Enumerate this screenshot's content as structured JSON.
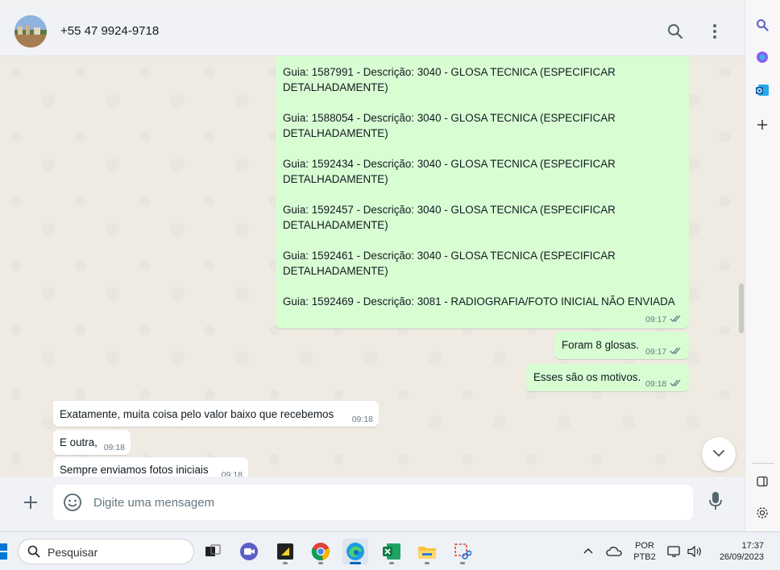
{
  "header": {
    "contact_name": "+55 47 9924-9718"
  },
  "outgoing_list": {
    "lines": [
      {
        "line1": "Guia: 1587991 - Descrição: 3040 - GLOSA TECNICA (ESPECIFICAR",
        "line2": "DETALHADAMENTE)"
      },
      {
        "line1": "Guia: 1588054 - Descrição: 3040 - GLOSA TECNICA (ESPECIFICAR",
        "line2": "DETALHADAMENTE)"
      },
      {
        "line1": "Guia: 1592434 - Descrição: 3040 - GLOSA TECNICA (ESPECIFICAR",
        "line2": "DETALHADAMENTE)"
      },
      {
        "line1": "Guia: 1592457 - Descrição: 3040 - GLOSA TECNICA (ESPECIFICAR",
        "line2": "DETALHADAMENTE)"
      },
      {
        "line1": "Guia: 1592461 - Descrição: 3040 - GLOSA TECNICA (ESPECIFICAR",
        "line2": "DETALHADAMENTE)"
      },
      {
        "line1": "Guia: 1592469 - Descrição: 3081 - RADIOGRAFIA/FOTO INICIAL NÃO ENVIADA",
        "line2": ""
      }
    ],
    "time": "09:17"
  },
  "messages": [
    {
      "text": "Foram 8 glosas.",
      "time": "09:17",
      "direction": "out"
    },
    {
      "text": "Esses são os motivos.",
      "time": "09:18",
      "direction": "out"
    },
    {
      "text": "Exatamente, muita coisa pelo valor baixo que recebemos",
      "time": "09:18",
      "direction": "in"
    },
    {
      "text": "E outra,",
      "time": "09:18",
      "direction": "in"
    },
    {
      "text": "Sempre enviamos fotos iniciais",
      "time": "09:18",
      "direction": "in"
    }
  ],
  "composer": {
    "placeholder": "Digite uma mensagem"
  },
  "taskbar": {
    "search_label": "Pesquisar",
    "lang_top": "POR",
    "lang_bottom": "PTB2",
    "clock_time": "17:37",
    "clock_date": "26/09/2023"
  },
  "colors": {
    "outgoing_bubble": "#d9fdd3",
    "incoming_bubble": "#ffffff",
    "chat_bg": "#efeae2",
    "read_ticks": "#53bdeb"
  },
  "icons": {
    "header": [
      "search-icon",
      "menu-dots-icon"
    ],
    "sidebar": [
      "search-icon",
      "copilot-icon",
      "outlook-icon",
      "plus-icon",
      "sidebar-toggle-icon",
      "settings-icon"
    ]
  }
}
